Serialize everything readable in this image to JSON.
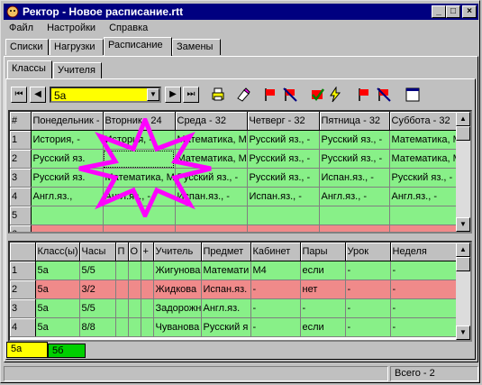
{
  "window": {
    "title": "Ректор - Новое расписание.rtt"
  },
  "menu": [
    "Файл",
    "Настройки",
    "Справка"
  ],
  "tabs_main": [
    {
      "label": "Списки"
    },
    {
      "label": "Нагрузки"
    },
    {
      "label": "Расписание"
    },
    {
      "label": "Замены"
    }
  ],
  "tabs_sub": [
    {
      "label": "Классы"
    },
    {
      "label": "Учителя"
    }
  ],
  "toolbar": {
    "class_value": "5а"
  },
  "schedule": {
    "headers": [
      "#",
      "Понедельник -",
      "Вторник - 24",
      "Среда - 32",
      "Четверг - 32",
      "Пятница - 32",
      "Суббота - 32"
    ],
    "rows": [
      {
        "n": "1",
        "cells": [
          "История, -",
          "История, -",
          "Математика, М",
          "Русский яз., -",
          "Русский яз., -",
          "Математика, М"
        ]
      },
      {
        "n": "2",
        "cells": [
          "Русский яз.",
          "",
          "Математика, М",
          "Русский яз., -",
          "Русский яз., -",
          "Математика, М"
        ]
      },
      {
        "n": "3",
        "cells": [
          "Русский яз.",
          "Математика, М",
          "Русский яз., -",
          "Русский яз., -",
          "Испан.яз., -",
          "Русский яз., -"
        ]
      },
      {
        "n": "4",
        "cells": [
          "Англ.яз.,",
          "Англ.яз., -",
          "Испан.яз., -",
          "Испан.яз., -",
          "Англ.яз., -",
          "Англ.яз., -"
        ]
      },
      {
        "n": "5",
        "cells": [
          "",
          "",
          "",
          "",
          "",
          ""
        ]
      },
      {
        "n": "6",
        "cells": [
          "",
          "",
          "",
          "",
          "",
          ""
        ]
      },
      {
        "n": "7",
        "cells": [
          "",
          "",
          "",
          "",
          "",
          ""
        ]
      }
    ]
  },
  "load": {
    "headers": [
      "",
      "Класс(ы)",
      "Часы",
      "П",
      "О",
      "+",
      "Учитель",
      "Предмет",
      "Кабинет",
      "Пары",
      "Урок",
      "Неделя"
    ],
    "rows": [
      {
        "n": "1",
        "cells": [
          "5а",
          "5/5",
          "",
          "",
          "",
          "Жигунова",
          "Математи",
          "М4",
          "если",
          "-",
          "-"
        ]
      },
      {
        "n": "2",
        "cells": [
          "5а",
          "3/2",
          "",
          "",
          "",
          "Жидкова",
          "Испан.яз.",
          "-",
          "нет",
          "-",
          "-"
        ]
      },
      {
        "n": "3",
        "cells": [
          "5а",
          "5/5",
          "",
          "",
          "",
          "Задорожн",
          "Англ.яз.",
          "-",
          "-",
          "-",
          "-"
        ]
      },
      {
        "n": "4",
        "cells": [
          "5а",
          "8/8",
          "",
          "",
          "",
          "Чуванова",
          "Русский я",
          "-",
          "если",
          "-",
          "-"
        ]
      }
    ]
  },
  "bottom_tabs": [
    {
      "label": "5а"
    },
    {
      "label": "5б"
    }
  ],
  "status": {
    "total": "Всего - 2"
  },
  "colors": {
    "title_bg": "#000080",
    "green_row": "#88f088",
    "red_row": "#f08a8a",
    "combo_bg": "#ffff00",
    "star": "#ff00ff"
  }
}
